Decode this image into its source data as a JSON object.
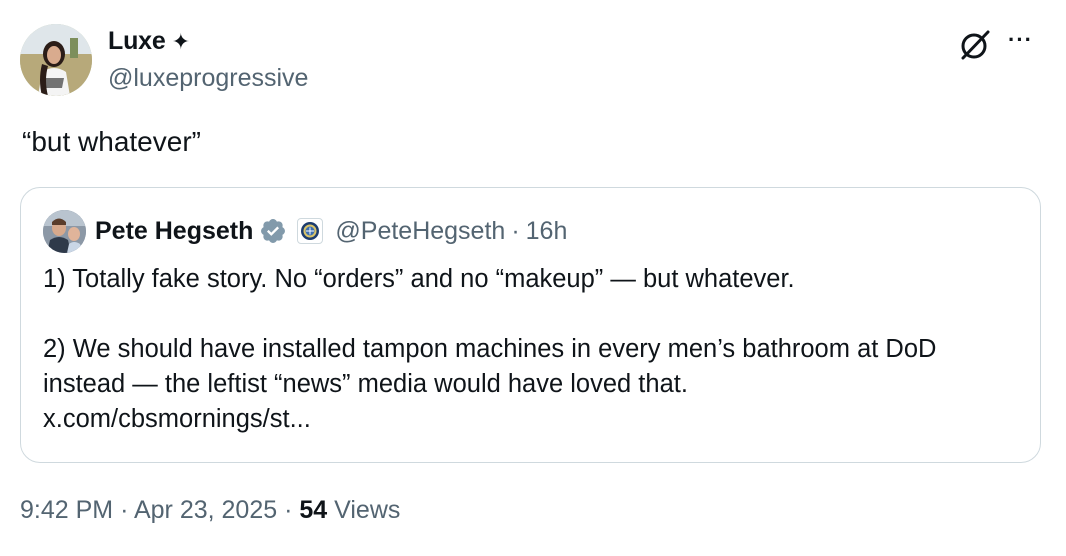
{
  "author": {
    "name": "Luxe",
    "badge_glyph": "✦",
    "handle": "@luxeprogressive"
  },
  "tweet": {
    "text": "“but whatever”"
  },
  "quoted": {
    "name": "Pete Hegseth",
    "handle": "@PeteHegseth",
    "separator": "·",
    "time": "16h",
    "paragraph_1": "1) Totally fake story. No “orders” and no “makeup” — but whatever.",
    "paragraph_2_line_1": "2) We should have installed tampon machines in every men’s bathroom at DoD",
    "paragraph_2_line_2": "instead — the leftist “news” media would have loved that.",
    "link": "x.com/cbsmornings/st..."
  },
  "footer": {
    "time": "9:42 PM",
    "sep1": "·",
    "date": "Apr 23, 2025",
    "sep2": "·",
    "views_count": "54",
    "views_label": "Views"
  },
  "icons": {
    "grok": "grok-icon",
    "more": "more-icon",
    "verified": "verified-badge-icon",
    "affiliate": "dod-seal-icon"
  },
  "colors": {
    "text_primary": "#0f1419",
    "text_secondary": "#536471",
    "border": "#cfd9de",
    "verified_gray": "#829aab"
  }
}
